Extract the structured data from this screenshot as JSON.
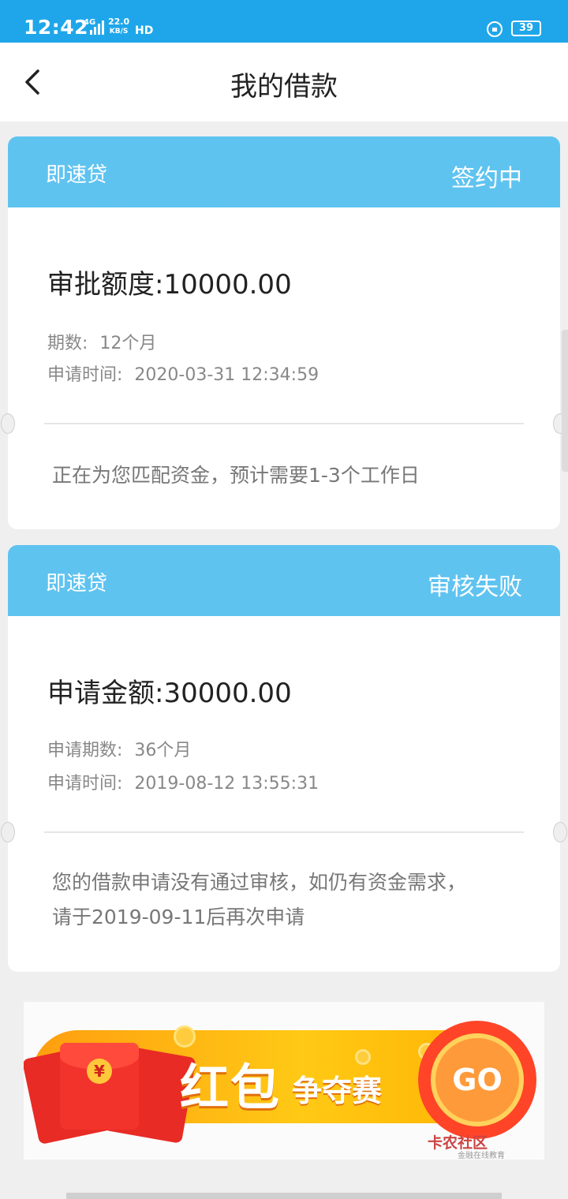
{
  "status_bar": {
    "time": "12:42",
    "network": "4G",
    "speed_value": "22.0",
    "speed_unit": "KB/S",
    "hd": "HD",
    "battery": "39"
  },
  "nav": {
    "title": "我的借款"
  },
  "loans": [
    {
      "product": "即速贷",
      "status": "签约中",
      "amount_label": "审批额度:",
      "amount": "10000.00",
      "term_label": "期数:",
      "term": "12个月",
      "time_label": "申请时间:",
      "time": "2020-03-31 12:34:59",
      "notice": "正在为您匹配资金，预计需要1-3个工作日"
    },
    {
      "product": "即速贷",
      "status": "审核失败",
      "amount_label": "申请金额:",
      "amount": "30000.00",
      "term_label": "申请期数:",
      "term": "36个月",
      "time_label": "申请时间:",
      "time": "2019-08-12 13:55:31",
      "notice_line1": "您的借款申请没有通过审核，如仍有资金需求，",
      "notice_line2": "请于2019-09-11后再次申请"
    }
  ],
  "banner": {
    "title_big": "红包",
    "title_small": "争夺赛",
    "go_label": "GO",
    "yuan": "¥",
    "watermark": "卡农社区",
    "watermark_sub": "金融在线教育"
  },
  "colors": {
    "status_bar": "#1fa6ea",
    "card_header": "#5fc3f0",
    "background": "#efefef"
  }
}
